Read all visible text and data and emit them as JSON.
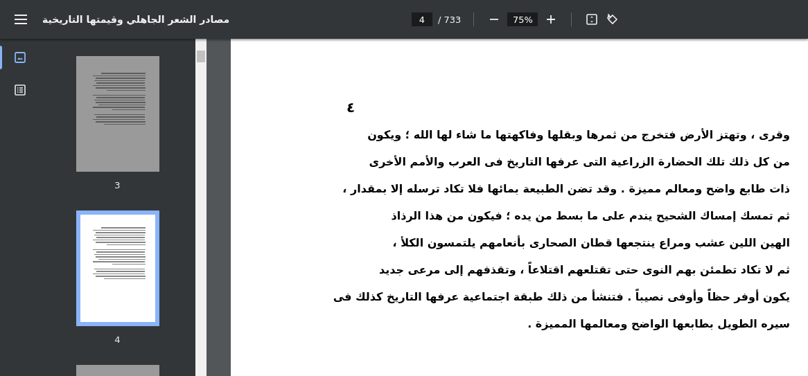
{
  "toolbar": {
    "title": "مصادر الشعر الجاهلي وقيمتها التاريخية",
    "page_input": "4",
    "page_total": "/ 733",
    "zoom": "75%"
  },
  "sidebar": {
    "views": [
      {
        "kind": "thumbnails",
        "selected": true
      },
      {
        "kind": "outline",
        "selected": false
      }
    ],
    "thumbnails": [
      {
        "label": "3",
        "selected": false
      },
      {
        "label": "4",
        "selected": true
      },
      {
        "selected": false
      }
    ]
  },
  "page": {
    "number": "٤",
    "lines": [
      "وقرى ، وتهتز الأرض فتخرج من ثمرها وبقلها وفاكهتها ما شاء لها الله ؛ ويكون",
      "من كل ذلك تلك الحضارة الزراعية التى عرفها التاريخ فى العرب والأمم الأخرى",
      "ذات طابع واضح ومعالم مميزة . وقد تضن الطبيعة بمائها فلا تكاد ترسله إلا بمقدار ،",
      "ثم تمسك إمساك الشحيح يندم على ما بسط من يده ؛ فيكون من هذا الرذاذ",
      "الهين اللين عشب ومراع ينتجعها قطان الصحارى بأنعامهم يلتمسون الكلأ ،",
      "ثم لا تكاد تطمئن بهم النوى حتى تقتلعهم اقتلاعاً ، وتقذفهم إلى مرعى جديد",
      "يكون أوفر حظاً وأوفى نصيباً . فتنشأ من ذلك طبقة اجتماعية عرفها التاريخ كذلك فى",
      "سيره الطويل بطابعها الواضح ومعالمها المميزة ."
    ]
  }
}
